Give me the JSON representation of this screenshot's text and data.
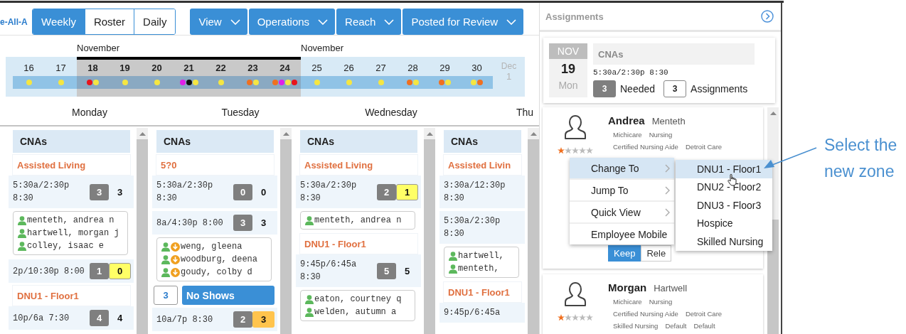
{
  "toolbar": {
    "link": "e-All-A",
    "views": [
      {
        "label": "Weekly",
        "selected": true
      },
      {
        "label": "Roster",
        "selected": false
      },
      {
        "label": "Daily",
        "selected": false
      }
    ],
    "menus": [
      {
        "label": "View"
      },
      {
        "label": "Operations"
      },
      {
        "label": "Reach"
      },
      {
        "label": "Posted for Review"
      }
    ]
  },
  "date_strip": {
    "days": [
      {
        "label": "16",
        "selected": false,
        "disabled": false,
        "dots": [
          {
            "color": "#f5e642"
          }
        ]
      },
      {
        "label": "17",
        "selected": false,
        "disabled": false,
        "dots": [
          {
            "color": "#f5e642"
          }
        ]
      },
      {
        "label": "18",
        "month": "November",
        "selected": true,
        "disabled": false,
        "dots": [
          {
            "color": "#e8141c"
          },
          {
            "color": "#f5e642"
          }
        ]
      },
      {
        "label": "19",
        "selected": true,
        "disabled": false,
        "dots": [
          {
            "color": "#f5e642"
          }
        ]
      },
      {
        "label": "20",
        "selected": true,
        "disabled": false,
        "dots": [
          {
            "color": "#f5e642"
          }
        ]
      },
      {
        "label": "21",
        "selected": true,
        "disabled": false,
        "dots": [
          {
            "color": "#e020e8"
          },
          {
            "color": "#111111"
          },
          {
            "color": "#f5e642"
          }
        ]
      },
      {
        "label": "22",
        "selected": true,
        "disabled": false,
        "dots": [
          {
            "color": "#f5e642"
          }
        ]
      },
      {
        "label": "23",
        "selected": true,
        "disabled": false,
        "dots": [
          {
            "color": "#f07020"
          },
          {
            "color": "#f5e642"
          }
        ]
      },
      {
        "label": "24",
        "selected": true,
        "disabled": false,
        "dots": [
          {
            "color": "#f07020"
          },
          {
            "color": "#e020e8"
          },
          {
            "color": "#f5e642"
          },
          {
            "color": "#e8141c"
          }
        ]
      },
      {
        "label": "25",
        "month": "November",
        "selected": false,
        "disabled": false,
        "dots": [
          {
            "color": "#f5e642"
          }
        ]
      },
      {
        "label": "26",
        "selected": false,
        "disabled": false,
        "dots": [
          {
            "color": "#f5e642"
          }
        ]
      },
      {
        "label": "27",
        "selected": false,
        "disabled": false,
        "dots": [
          {
            "color": "#f5e642"
          }
        ]
      },
      {
        "label": "28",
        "selected": false,
        "disabled": false,
        "dots": [
          {
            "color": "#f07020"
          },
          {
            "color": "#f5e642"
          }
        ]
      },
      {
        "label": "29",
        "selected": false,
        "disabled": false,
        "dots": [
          {
            "color": "#f07020"
          },
          {
            "color": "#f5e642"
          }
        ]
      },
      {
        "label": "30",
        "selected": false,
        "disabled": false,
        "dots": [
          {
            "color": "#f5e642"
          },
          {
            "color": "#f07020"
          }
        ]
      },
      {
        "label": "1",
        "prefix": "Dec",
        "selected": false,
        "disabled": true
      }
    ]
  },
  "columns": [
    {
      "day": "Monday",
      "blocks": [
        {
          "kind": "group",
          "text": "CNAs"
        },
        {
          "kind": "zone",
          "text": "Assisted Living"
        },
        {
          "kind": "shift",
          "time": "5:30a/2:30p 8:30",
          "needed": "3",
          "assigned": "3",
          "short": false,
          "over": false
        },
        {
          "kind": "staff",
          "people": [
            {
              "name": "menteth, andrea n",
              "alert": false
            },
            {
              "name": "hartwell, morgan j",
              "alert": false
            },
            {
              "name": "colley, isaac e",
              "alert": false
            }
          ]
        },
        {
          "kind": "shift",
          "time": "2p/10:30p 8:00",
          "needed": "1",
          "assigned": "0",
          "short": true,
          "over": false
        },
        {
          "kind": "zone",
          "text": "DNU1 - Floor1"
        },
        {
          "kind": "shift",
          "time": "10p/6a 7:30",
          "needed": "4",
          "assigned": "4",
          "short": false,
          "over": false
        }
      ]
    },
    {
      "day": "Tuesday",
      "blocks": [
        {
          "kind": "group",
          "text": "CNAs"
        },
        {
          "kind": "zone",
          "text": "5?0"
        },
        {
          "kind": "shift",
          "time": "5:30a/2:30p 8:30",
          "needed": "0",
          "assigned": "0",
          "short": false,
          "over": false
        },
        {
          "kind": "shift",
          "time": "8a/4:30p 8:00",
          "needed": "3",
          "assigned": "3",
          "short": false,
          "over": false
        },
        {
          "kind": "staff",
          "people": [
            {
              "name": "weng, gleena",
              "alert": true
            },
            {
              "name": "woodburg, deena",
              "alert": true
            },
            {
              "name": "goudy, colby d",
              "alert": true
            }
          ]
        },
        {
          "kind": "no_shows",
          "count": "3",
          "label": "No Shows"
        },
        {
          "kind": "shift",
          "time": "10a/7p 8:30",
          "needed": "2",
          "assigned": "3",
          "short": false,
          "over": true
        }
      ]
    },
    {
      "day": "Wednesday",
      "blocks": [
        {
          "kind": "group",
          "text": "CNAs"
        },
        {
          "kind": "zone",
          "text": "Assisted Living"
        },
        {
          "kind": "shift",
          "time": "5:30a/2:30p 8:30",
          "needed": "2",
          "assigned": "1",
          "short": true,
          "over": false
        },
        {
          "kind": "staff",
          "people": [
            {
              "name": "menteth, andrea n",
              "alert": false
            }
          ]
        },
        {
          "kind": "zone",
          "text": "DNU1 - Floor1"
        },
        {
          "kind": "shift",
          "time": "9:45p/6:45a 8:30",
          "needed": "5",
          "assigned": "5",
          "short": false,
          "over": false
        },
        {
          "kind": "staff",
          "people": [
            {
              "name": "eaton, courtney q",
              "alert": false
            },
            {
              "name": "welden, autumn a",
              "alert": false
            }
          ]
        }
      ]
    },
    {
      "day": "Thu",
      "blocks": [
        {
          "kind": "group",
          "text": "CNAs"
        },
        {
          "kind": "zone",
          "text": "Assisted Livin"
        },
        {
          "kind": "shift",
          "time": "3:30a/12:30p 8:30"
        },
        {
          "kind": "shift",
          "time": "5:30a/2:30p 8:30"
        },
        {
          "kind": "staff",
          "people": [
            {
              "name": "hartwell,",
              "alert": false
            },
            {
              "name": "menteth,",
              "alert": false
            }
          ]
        },
        {
          "kind": "zone",
          "text": "DNU1 - Floor1"
        },
        {
          "kind": "shift",
          "time": "9:45p/6:45a"
        }
      ]
    }
  ],
  "assignments": {
    "title": "Assignments",
    "summary": {
      "month": "NOV",
      "day": "19",
      "weekday": "Mon",
      "group": "CNAs",
      "time": "5:30a/2:30p 8:30",
      "needed": "3",
      "needed_label": "Needed",
      "assigned": "3",
      "assigned_label": "Assignments"
    },
    "cards": [
      {
        "first": "Andrea",
        "last": "Menteth",
        "stars": 1,
        "tag_rows": [
          [
            "Michicare",
            "Nursing"
          ],
          [
            "Certified Nursing Aide",
            "Detroit Care"
          ]
        ],
        "actions": [
          {
            "label": "Keep",
            "selected": true
          },
          {
            "label": "Rele",
            "selected": false
          }
        ]
      },
      {
        "first": "Morgan",
        "last": "Hartwell",
        "stars": 1,
        "tag_rows": [
          [
            "Michicare",
            "Nursing"
          ],
          [
            "Certified Nursing Aide",
            "Detroit Care"
          ],
          [
            "Skilled Nursing",
            "Default",
            "Default"
          ]
        ]
      }
    ],
    "menu": {
      "items": [
        {
          "label": "Change To",
          "submenu": true,
          "selected": true
        },
        {
          "label": "Jump To",
          "submenu": true,
          "selected": false
        },
        {
          "label": "Quick View",
          "submenu": true,
          "selected": false
        },
        {
          "label": "Employee Mobile",
          "submenu": false,
          "selected": false
        }
      ],
      "submenu_items": [
        {
          "label": "DNU1 - Floor1",
          "selected": true
        },
        {
          "label": "DNU2 - Floor2",
          "selected": false
        },
        {
          "label": "DNU3 - Floor3",
          "selected": false
        },
        {
          "label": "Hospice",
          "selected": false
        },
        {
          "label": "Skilled Nursing",
          "selected": false
        }
      ]
    }
  },
  "annotation": {
    "text": "Select the new zone"
  }
}
